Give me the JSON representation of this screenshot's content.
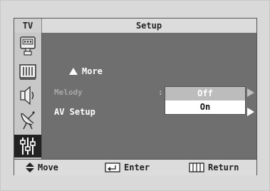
{
  "header": {
    "source_label": "TV",
    "title": "Setup"
  },
  "sidebar": {
    "icons": [
      "picture-icon",
      "sound-icon",
      "speaker-icon",
      "antenna-icon",
      "setup-sliders-icon"
    ],
    "selected_icon": "setup-sliders-icon"
  },
  "menu": {
    "more_label": "More",
    "melody_label": "Melody",
    "melody_separator": ":",
    "av_setup_label": "AV Setup",
    "dropdown_options": [
      "Off",
      "On"
    ],
    "highlighted_option": "On"
  },
  "footer": {
    "move_label": "Move",
    "enter_label": "Enter",
    "return_label": "Return"
  },
  "colors": {
    "panel_bg": "#6f6f6f",
    "bar_bg": "#dcdcdc",
    "sidebar_bg": "#c8c8c8",
    "selected_icon_bg": "#222222"
  }
}
